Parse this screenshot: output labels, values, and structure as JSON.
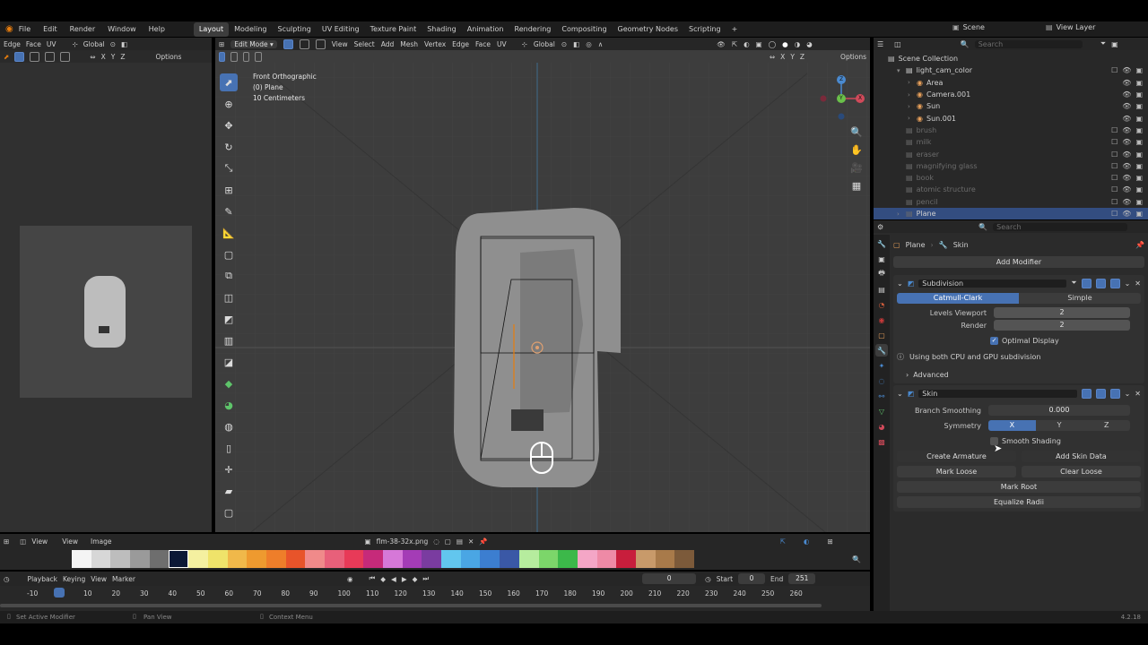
{
  "menubar": {
    "items": [
      "File",
      "Edit",
      "Render",
      "Window",
      "Help"
    ],
    "workspaces": [
      "Layout",
      "Modeling",
      "Sculpting",
      "UV Editing",
      "Texture Paint",
      "Shading",
      "Animation",
      "Rendering",
      "Compositing",
      "Geometry Nodes",
      "Scripting",
      "+"
    ],
    "scene": "Scene",
    "view_layer": "View Layer"
  },
  "uv_editor": {
    "header": [
      "Edge",
      "Face",
      "UV",
      "Global"
    ],
    "options": "Options",
    "xyz": [
      "X",
      "Y",
      "Z"
    ],
    "footer": {
      "view": "View",
      "view2": "View",
      "image": "Image",
      "filename": "flm-38-32x.png"
    }
  },
  "viewport": {
    "mode": "Edit Mode",
    "menus": [
      "View",
      "Select",
      "Add",
      "Mesh",
      "Vertex",
      "Edge",
      "Face",
      "UV"
    ],
    "orientation": "Global",
    "options": "Options",
    "xyz": [
      "X",
      "Y",
      "Z"
    ],
    "overlay": [
      "Front Orthographic",
      "(0) Plane",
      "10 Centimeters"
    ],
    "gizmo": {
      "z": "Z",
      "y": "Y",
      "x": "X"
    }
  },
  "outliner": {
    "search": "Search",
    "root": "Scene Collection",
    "rows": [
      {
        "name": "light_cam_color",
        "level": 1,
        "dim": false,
        "expand": "▾"
      },
      {
        "name": "Area",
        "level": 2,
        "dim": false,
        "expand": "›"
      },
      {
        "name": "Camera.001",
        "level": 2,
        "dim": false,
        "expand": "›"
      },
      {
        "name": "Sun",
        "level": 2,
        "dim": false,
        "expand": "›"
      },
      {
        "name": "Sun.001",
        "level": 2,
        "dim": false,
        "expand": "›"
      },
      {
        "name": "brush",
        "level": 1,
        "dim": true,
        "expand": ""
      },
      {
        "name": "milk",
        "level": 1,
        "dim": true,
        "expand": ""
      },
      {
        "name": "eraser",
        "level": 1,
        "dim": true,
        "expand": ""
      },
      {
        "name": "magnifying glass",
        "level": 1,
        "dim": true,
        "expand": ""
      },
      {
        "name": "book",
        "level": 1,
        "dim": true,
        "expand": ""
      },
      {
        "name": "atomic structure",
        "level": 1,
        "dim": true,
        "expand": ""
      },
      {
        "name": "pencil",
        "level": 1,
        "dim": true,
        "expand": ""
      },
      {
        "name": "Plane",
        "level": 1,
        "dim": true,
        "expand": "›",
        "selected": true
      }
    ]
  },
  "properties": {
    "search": "Search",
    "breadcrumb": {
      "object": "Plane",
      "modifier": "Skin"
    },
    "add_modifier": "Add Modifier",
    "subdivision": {
      "name": "Subdivision",
      "catmull": "Catmull-Clark",
      "simple": "Simple",
      "levels_label": "Levels Viewport",
      "levels_value": "2",
      "render_label": "Render",
      "render_value": "2",
      "optimal": "Optimal Display",
      "info": "Using both CPU and GPU subdivision",
      "advanced": "Advanced"
    },
    "skin": {
      "name": "Skin",
      "branch_label": "Branch Smoothing",
      "branch_value": "0.000",
      "symmetry_label": "Symmetry",
      "sym_x": "X",
      "sym_y": "Y",
      "sym_z": "Z",
      "smooth": "Smooth Shading",
      "create_armature": "Create Armature",
      "add_skin_data": "Add Skin Data",
      "mark_loose": "Mark Loose",
      "clear_loose": "Clear Loose",
      "mark_root": "Mark Root",
      "equalize": "Equalize Radii"
    }
  },
  "timeline": {
    "menus": [
      "Playback",
      "Keying",
      "View",
      "Marker"
    ],
    "current_frame": "0",
    "start_label": "Start",
    "start": "0",
    "end_label": "End",
    "end": "251",
    "ticks": [
      "-10",
      "0",
      "10",
      "20",
      "30",
      "40",
      "50",
      "60",
      "70",
      "80",
      "90",
      "100",
      "110",
      "120",
      "130",
      "140",
      "150",
      "160",
      "170",
      "180",
      "190",
      "200",
      "210",
      "220",
      "230",
      "240",
      "250",
      "260"
    ]
  },
  "statusbar": {
    "left": "Set Active Modifier",
    "mid": "Pan View",
    "right": "Context Menu",
    "version": "4.2.18"
  },
  "palette": [
    "#f4f4f4",
    "#d7d7d7",
    "#bdbdbd",
    "#9a9a9a",
    "#6e6e6e",
    "#0c1836",
    "#f4f0a0",
    "#efe36a",
    "#f0b84a",
    "#ee9a2f",
    "#ee7e2a",
    "#e8542a",
    "#f08a8a",
    "#e8607a",
    "#e83a58",
    "#c62a7a",
    "#d678d8",
    "#a43cb6",
    "#7a3ca0",
    "#62c6ee",
    "#4aa6e4",
    "#3c7ed0",
    "#3a58a6",
    "#b6ec9e",
    "#7cd66a",
    "#3cb84a",
    "#f4a6c6",
    "#ee8aa6",
    "#c81e3c",
    "#c89a6a",
    "#a87a4a",
    "#7c5a3a"
  ]
}
